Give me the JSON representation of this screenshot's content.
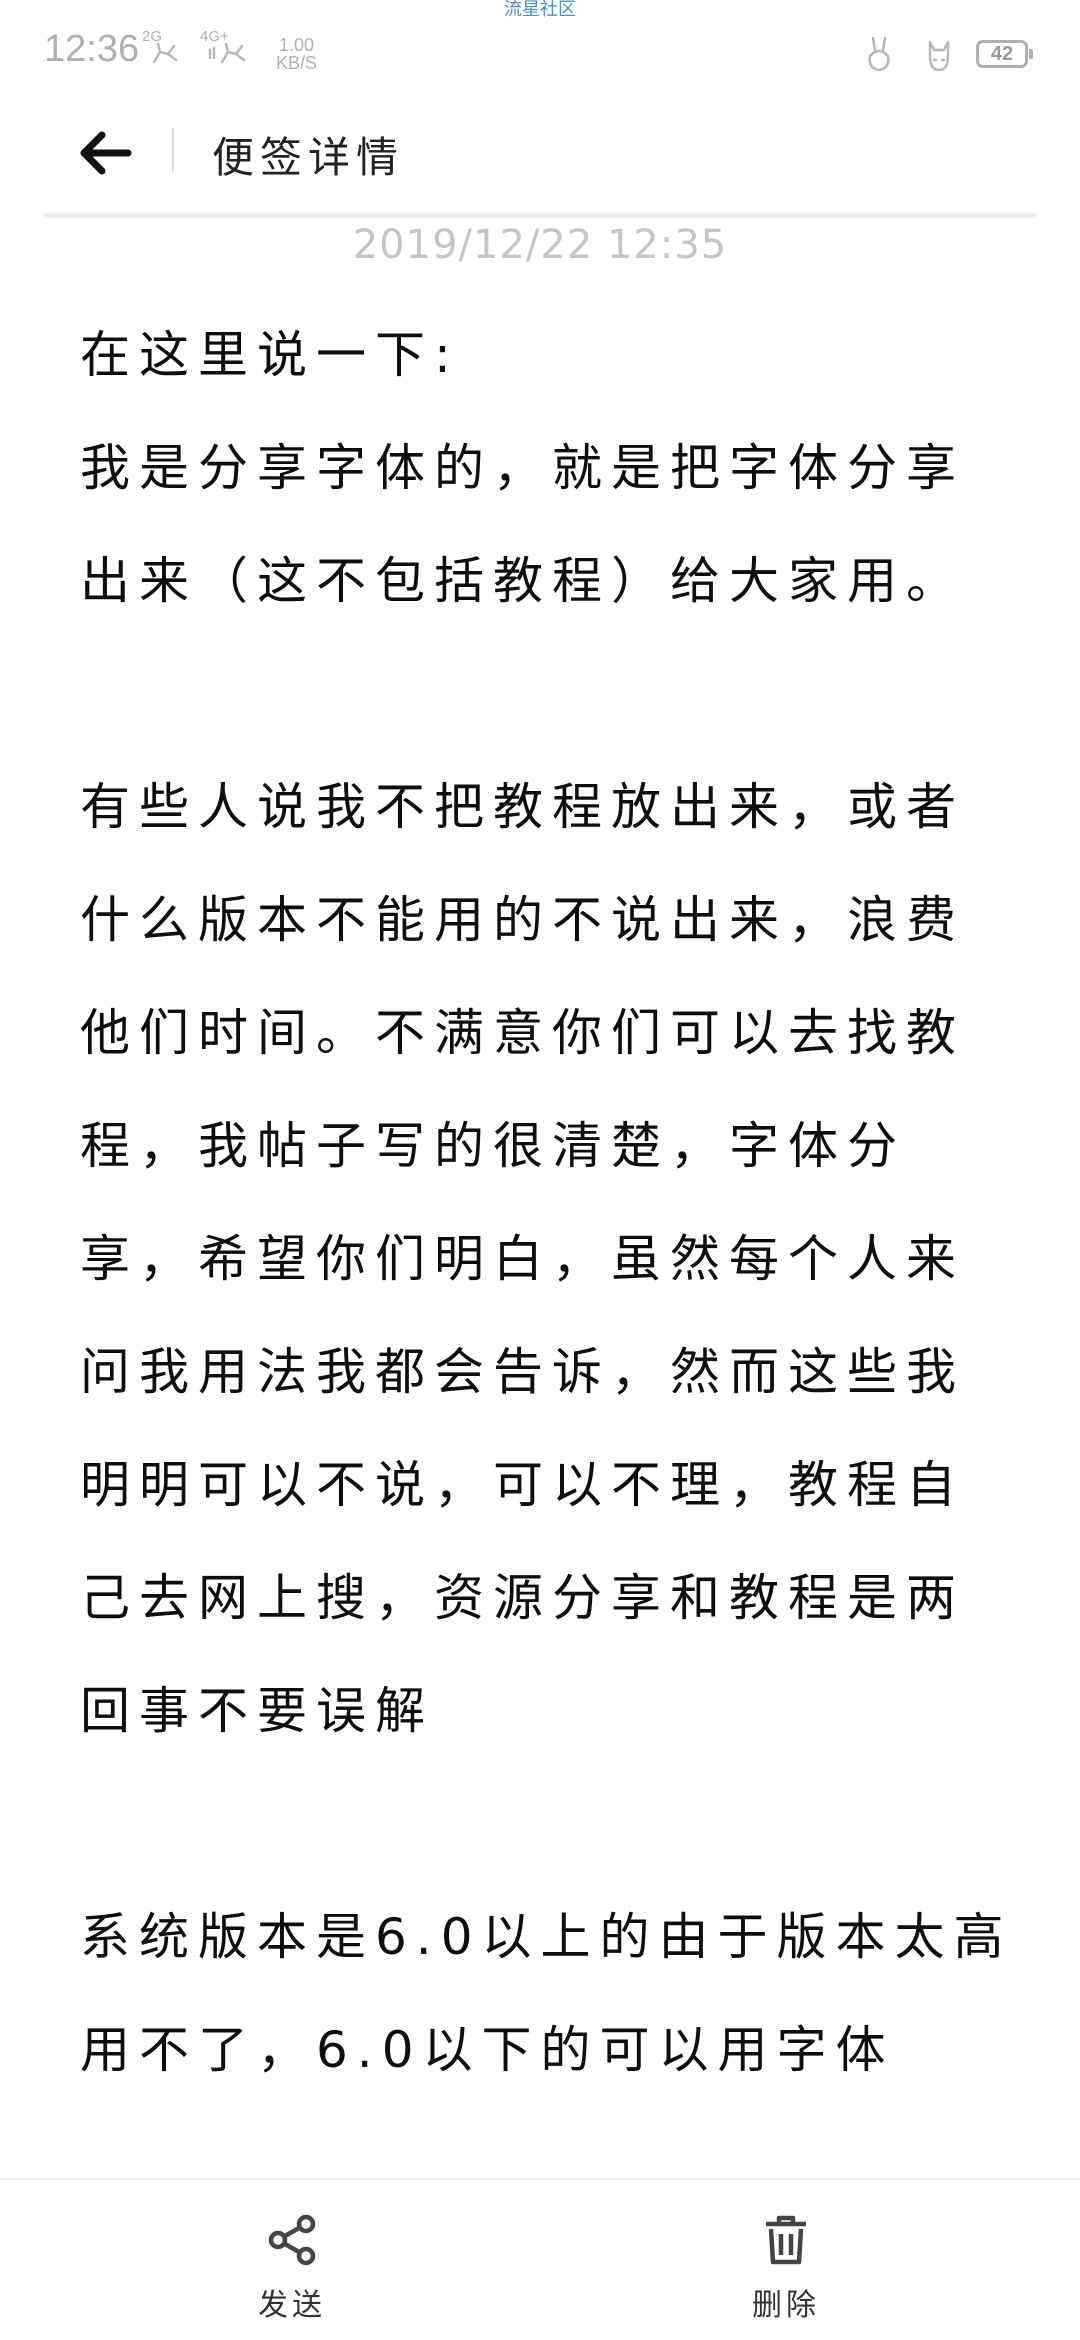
{
  "status_bar": {
    "watermark": "流星社区",
    "time": "12:36",
    "network_1": "2G",
    "network_2": "4G+",
    "speed_value": "1.00",
    "speed_unit": "KB/S",
    "battery": "42"
  },
  "header": {
    "title": "便签详情"
  },
  "note": {
    "timestamp": "2019/12/22 12:35",
    "lines": [
      "在这里说一下:",
      "我是分享字体的，就是把字体分享",
      "出来（这不包括教程）给大家用。",
      "",
      "有些人说我不把教程放出来，或者",
      "什么版本不能用的不说出来，浪费",
      "他们时间。不满意你们可以去找教",
      "程，我帖子写的很清楚，字体分",
      "享，希望你们明白，虽然每个人来",
      "问我用法我都会告诉，然而这些我",
      "明明可以不说，可以不理，教程自",
      "己去网上搜，资源分享和教程是两",
      "回事不要误解",
      "",
      "系统版本是6.0以上的由于版本太高",
      "用不了，6.0以下的可以用字体"
    ]
  },
  "bottom_bar": {
    "send_label": "发送",
    "send_icon": "share-icon",
    "delete_label": "删除",
    "delete_icon": "trash-icon"
  }
}
